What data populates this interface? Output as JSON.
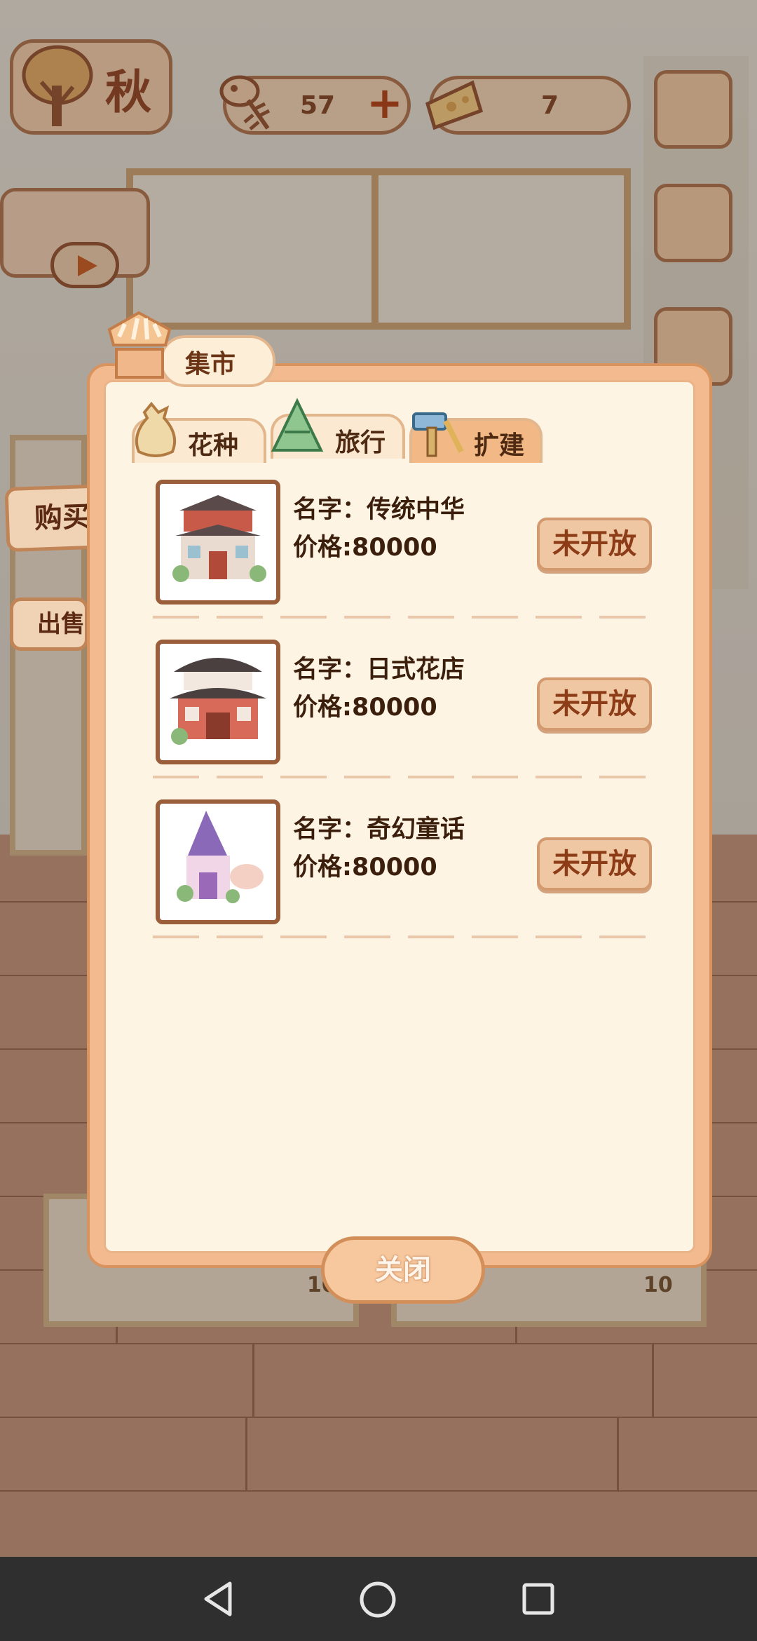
{
  "hud": {
    "season": "秋",
    "fish_count": "57",
    "cheese_count": "7",
    "plus_symbol": "+"
  },
  "side_tabs": {
    "buy": "购买",
    "sell": "出售"
  },
  "background": {
    "table_number_left": "10",
    "table_number_right": "10"
  },
  "market": {
    "title": "集市",
    "tabs": [
      {
        "label": "花种",
        "icon": "seed-bag-icon"
      },
      {
        "label": "旅行",
        "icon": "rice-dumpling-icon"
      },
      {
        "label": "扩建",
        "icon": "hammer-icon",
        "selected": true
      }
    ],
    "items": [
      {
        "name": "名字：传统中华",
        "price": "价格:80000",
        "status": "未开放",
        "thumb": "chinese-house-thumbnail"
      },
      {
        "name": "名字：日式花店",
        "price": "价格:80000",
        "status": "未开放",
        "thumb": "japanese-flower-shop-thumbnail"
      },
      {
        "name": "名字：奇幻童话",
        "price": "价格:80000",
        "status": "未开放",
        "thumb": "fairytale-house-thumbnail"
      }
    ],
    "close_label": "关闭"
  },
  "colors": {
    "panel_border": "#f3b98f",
    "panel_bg": "#fdf4e3",
    "button_text": "#8c3c16"
  }
}
